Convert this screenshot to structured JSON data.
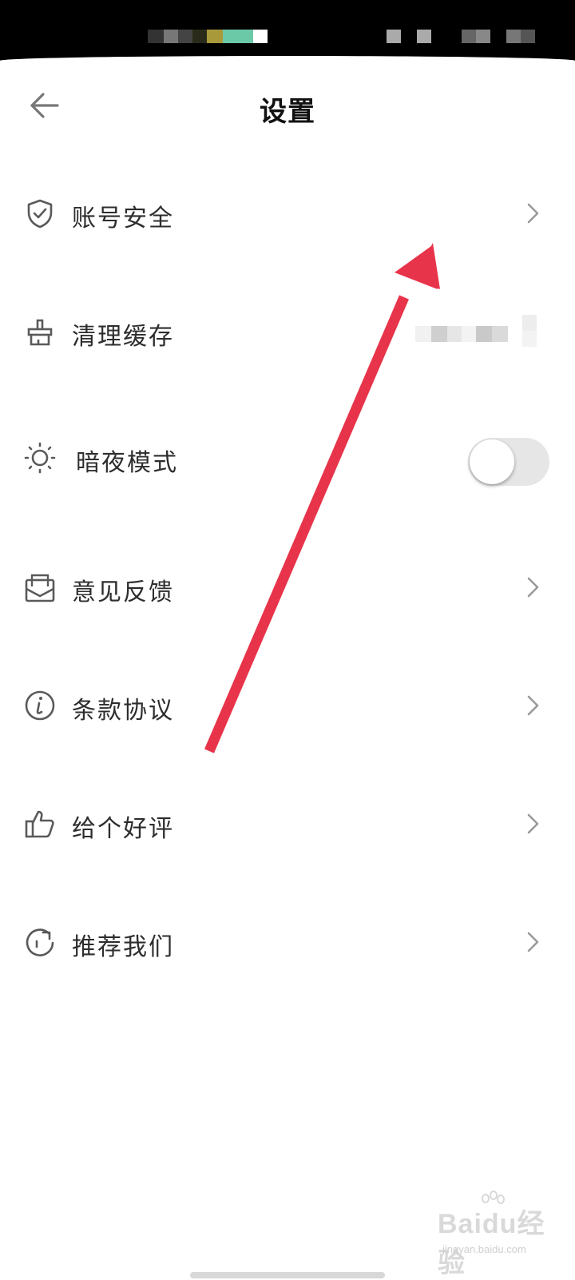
{
  "nav": {
    "title": "设置",
    "back_icon": "arrow-left-icon"
  },
  "settings": {
    "items": [
      {
        "label": "账号安全",
        "icon": "shield-check-icon",
        "trailing": "chevron"
      },
      {
        "label": "清理缓存",
        "icon": "broom-icon",
        "trailing": "value"
      },
      {
        "label": "暗夜模式",
        "icon": "sun-icon",
        "trailing": "toggle",
        "enabled": false
      },
      {
        "label": "意见反馈",
        "icon": "mail-icon",
        "trailing": "chevron"
      },
      {
        "label": "条款协议",
        "icon": "info-icon",
        "trailing": "chevron"
      },
      {
        "label": "给个好评",
        "icon": "thumbs-up-icon",
        "trailing": "chevron"
      },
      {
        "label": "推荐我们",
        "icon": "refresh-icon",
        "trailing": "chevron"
      }
    ]
  },
  "annotation": {
    "color": "#e8344a"
  },
  "watermark": {
    "text": "Baidu经验",
    "url": "jingyan.baidu.com"
  },
  "colors": {
    "icon": "#5a5a5a",
    "chevron": "#9a9a9a",
    "toggle_off": "#e6e6e6"
  }
}
